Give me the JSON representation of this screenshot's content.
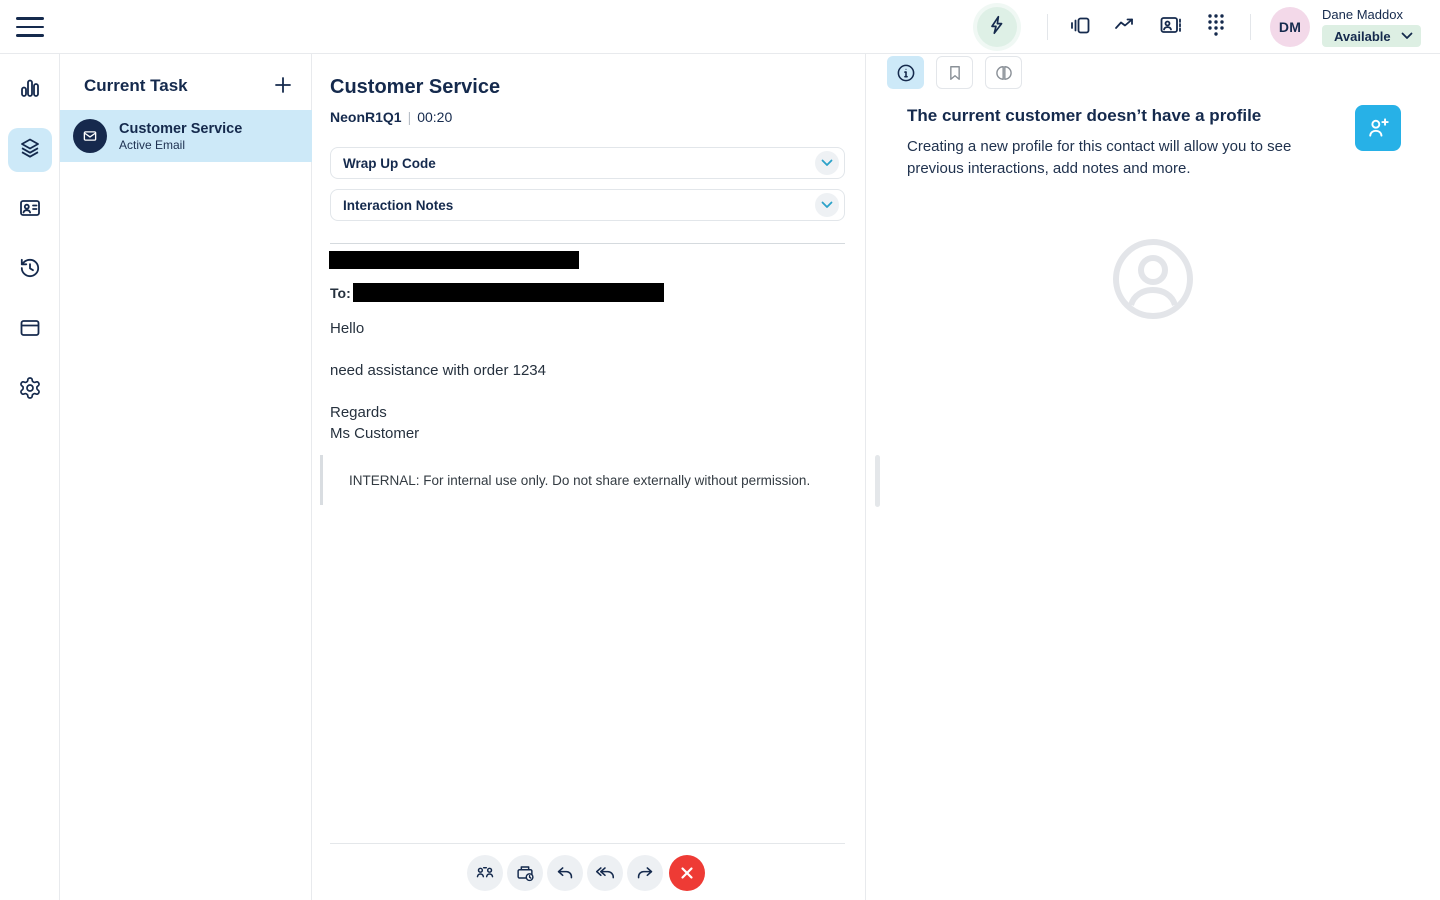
{
  "topbar": {
    "user": {
      "initials": "DM",
      "name": "Dane Maddox",
      "status": "Available"
    }
  },
  "task_panel": {
    "title": "Current Task",
    "items": [
      {
        "title": "Customer Service",
        "subtitle": "Active Email"
      }
    ]
  },
  "interaction": {
    "title": "Customer Service",
    "queue": "NeonR1Q1",
    "separator": "|",
    "timer": "00:20",
    "accordions": [
      {
        "label": "Wrap Up Code"
      },
      {
        "label": "Interaction Notes"
      }
    ],
    "email": {
      "to_label": "To:",
      "greeting": "Hello",
      "body_line": "need assistance with order 1234",
      "signoff": "Regards",
      "sender": "Ms Customer",
      "internal_note": "INTERNAL: For internal use only. Do not share externally without permission."
    }
  },
  "profile_panel": {
    "heading": "The current customer doesn’t have a profile",
    "description": "Creating a new profile for this contact will allow you to see previous interactions, add notes and more."
  },
  "colors": {
    "navy": "#152a4d",
    "selection_blue": "#cde9f8",
    "teal": "#2ba2c9",
    "cyan_button": "#27b1e7",
    "danger_red": "#ee3b35",
    "mint": "#ddefe3",
    "avatar_pink": "#f3d9e9"
  }
}
